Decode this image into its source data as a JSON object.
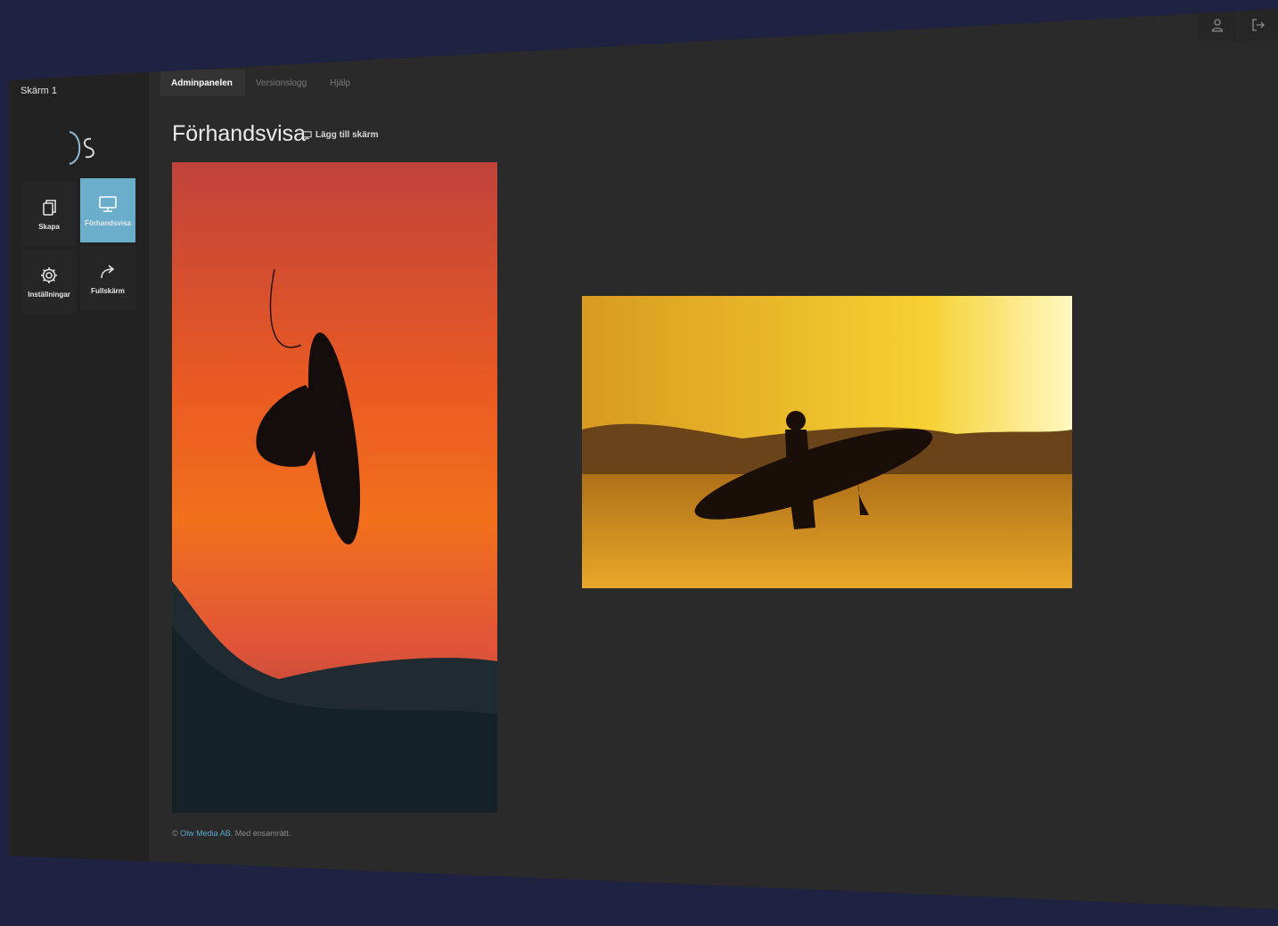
{
  "window": {
    "screen_name": "Skärm 1"
  },
  "tabs": [
    {
      "label": "Adminpanelen",
      "active": true
    },
    {
      "label": "Versionslogg",
      "active": false
    },
    {
      "label": "Hjälp",
      "active": false
    }
  ],
  "sidebar": {
    "logo_icon": "ds-logo",
    "items": [
      {
        "label": "Skapa",
        "icon": "copy-icon",
        "active": false
      },
      {
        "label": "Förhandsvisa",
        "icon": "monitor-icon",
        "active": true
      },
      {
        "label": "Inställningar",
        "icon": "gear-icon",
        "active": false
      },
      {
        "label": "Fullskärm",
        "icon": "share-icon",
        "active": false
      }
    ]
  },
  "main": {
    "title": "Förhandsvisa",
    "add_screen_label": "Lägg till skärm"
  },
  "footer": {
    "copyright_symbol": "©",
    "company": "Olw Media AB.",
    "rights": "Med ensamrätt."
  },
  "colors": {
    "accent": "#6aaecb",
    "background": "#1f2240",
    "panel": "#2a2a2a"
  }
}
